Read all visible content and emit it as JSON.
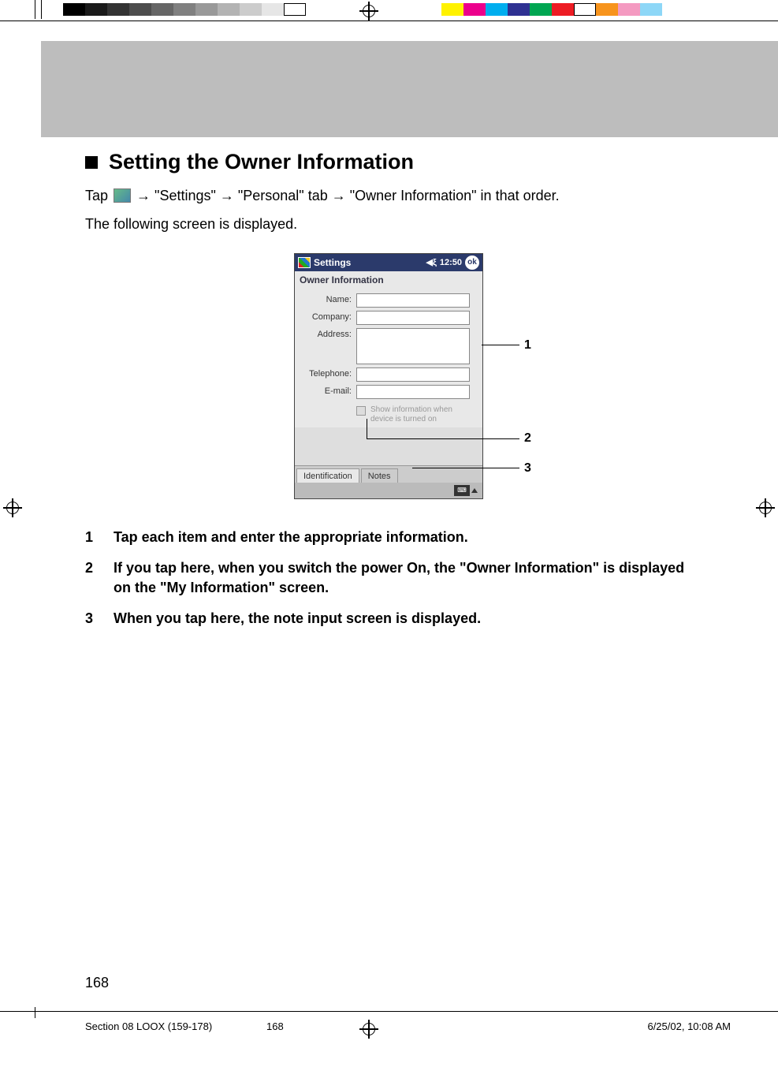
{
  "heading": "Setting the Owner Information",
  "intro_parts": {
    "pre": "Tap ",
    "seq1": " → \"Settings\" → \"Personal\" tab → \"Owner Information\" in that order.",
    "line2": "The following screen is displayed."
  },
  "screenshot": {
    "titlebar": {
      "app": "Settings",
      "time": "12:50",
      "ok": "ok"
    },
    "subtitle": "Owner Information",
    "fields": {
      "name": "Name:",
      "company": "Company:",
      "address": "Address:",
      "telephone": "Telephone:",
      "email": "E-mail:"
    },
    "checkbox_text": "Show information when device is turned on",
    "tabs": {
      "identification": "Identification",
      "notes": "Notes"
    }
  },
  "callouts": {
    "c1": "1",
    "c2": "2",
    "c3": "3"
  },
  "steps": [
    {
      "num": "1",
      "text": "Tap each item and enter the appropriate information."
    },
    {
      "num": "2",
      "text": "If you tap here, when you switch the power On, the \"Owner Information\" is displayed on the \"My Information\" screen."
    },
    {
      "num": "3",
      "text": "When you tap here, the note input screen is displayed."
    }
  ],
  "page_number": "168",
  "footer": {
    "section": "Section 08 LOOX (159-178)",
    "page": "168",
    "datetime": "6/25/02, 10:08 AM"
  },
  "registration_colors_gray": [
    "#000000",
    "#1a1a1a",
    "#333333",
    "#4d4d4d",
    "#666666",
    "#808080",
    "#999999",
    "#b3b3b3",
    "#cccccc",
    "#e6e6e6",
    "#ffffff"
  ],
  "registration_colors_color": [
    "#fff200",
    "#ec008c",
    "#00aeef",
    "#2e3192",
    "#00a651",
    "#ed1c24",
    "#ffffff",
    "#f7941d",
    "#f49ac1",
    "#8dd7f7"
  ]
}
